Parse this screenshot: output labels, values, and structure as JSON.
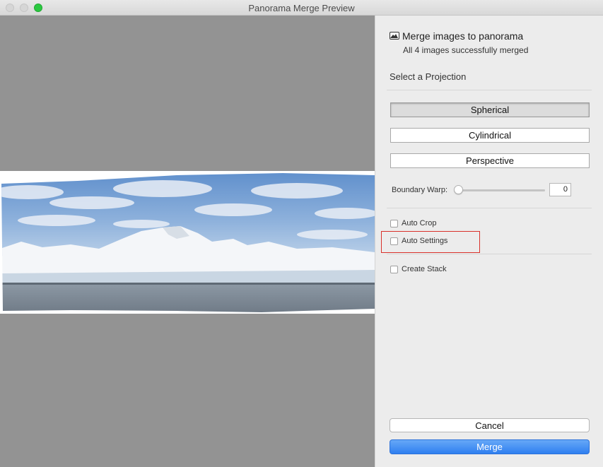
{
  "window": {
    "title": "Panorama Merge Preview"
  },
  "header": {
    "title": "Merge images to panorama",
    "subtitle": "All 4 images successfully merged",
    "icon": "image-icon"
  },
  "projection": {
    "label": "Select a Projection",
    "options": [
      "Spherical",
      "Cylindrical",
      "Perspective"
    ],
    "selected": "Spherical"
  },
  "boundary_warp": {
    "label": "Boundary Warp:",
    "value": "0"
  },
  "options": {
    "auto_crop": "Auto Crop",
    "auto_settings": "Auto Settings",
    "create_stack": "Create Stack"
  },
  "buttons": {
    "cancel": "Cancel",
    "merge": "Merge"
  },
  "colors": {
    "accent": "#2f7ff0",
    "highlight": "#d9312b",
    "preview_bg": "#939393"
  }
}
